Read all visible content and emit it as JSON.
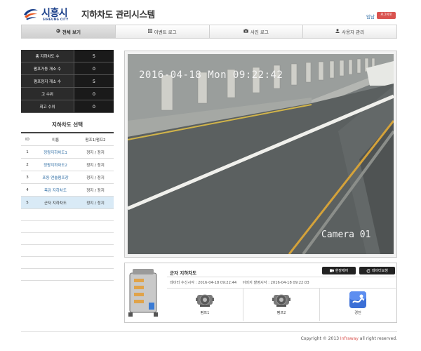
{
  "header": {
    "logo_ko": "시흥시",
    "logo_en": "SIHEUNG CITY",
    "title": "지하차도 관리시스템",
    "user": "임남",
    "logout_label": "로그아웃"
  },
  "tabs": [
    {
      "label": "전체 보기",
      "icon": "globe-icon",
      "active": true
    },
    {
      "label": "이벤트 로그",
      "icon": "list-icon",
      "active": false
    },
    {
      "label": "사진 로그",
      "icon": "camera-icon",
      "active": false
    },
    {
      "label": "사용자 관리",
      "icon": "user-icon",
      "active": false
    }
  ],
  "stats": [
    {
      "label": "총 지하차도 수",
      "value": "5"
    },
    {
      "label": "펌프가동 개소 수",
      "value": "0"
    },
    {
      "label": "펌프정지 개소 수",
      "value": "5"
    },
    {
      "label": "고 수위",
      "value": "0"
    },
    {
      "label": "최고 수위",
      "value": "0"
    }
  ],
  "underpass_select": {
    "title": "지하차도 선택",
    "columns": [
      "ID",
      "이름",
      "펌프1/펌프2"
    ],
    "rows": [
      {
        "id": "1",
        "name": "정왕지하차도1",
        "status": "정지 / 정지"
      },
      {
        "id": "2",
        "name": "정왕지하차도2",
        "status": "정지 / 정지"
      },
      {
        "id": "3",
        "name": "포동 앤솔펌프장",
        "status": "정지 / 정지"
      },
      {
        "id": "4",
        "name": "목감 지하차도",
        "status": "정지 / 정지"
      },
      {
        "id": "5",
        "name": "군자 지하차도",
        "status": "정지 / 정지",
        "selected": true
      }
    ]
  },
  "camera": {
    "timestamp": "2016-04-18 Mon 09:22:42",
    "name": "Camera 01"
  },
  "detail": {
    "name": "군자 지하차도",
    "control_label": "현장제어",
    "request_label": "데이터요청",
    "data_received_label": "데이터 수신시각 :",
    "data_received_value": "2016-04-18 09:22:44",
    "image_captured_label": "이미지 촬영시각 :",
    "image_captured_value": "2016-04-18 09:22:03",
    "cells": [
      {
        "label": "펌프1",
        "icon": "pump-icon"
      },
      {
        "label": "펌프2",
        "icon": "pump-icon"
      },
      {
        "label": "경전",
        "icon": "power-icon"
      }
    ]
  },
  "footer": {
    "copyright_prefix": "Copyright © 2013 ",
    "brand": "Infraway",
    "copyright_suffix": " all right reserved."
  },
  "colors": {
    "brand_blue": "#1a3f8a",
    "logout_red": "#d9534f",
    "link_blue": "#2e6da4",
    "selected_row": "#d9eaf6"
  }
}
